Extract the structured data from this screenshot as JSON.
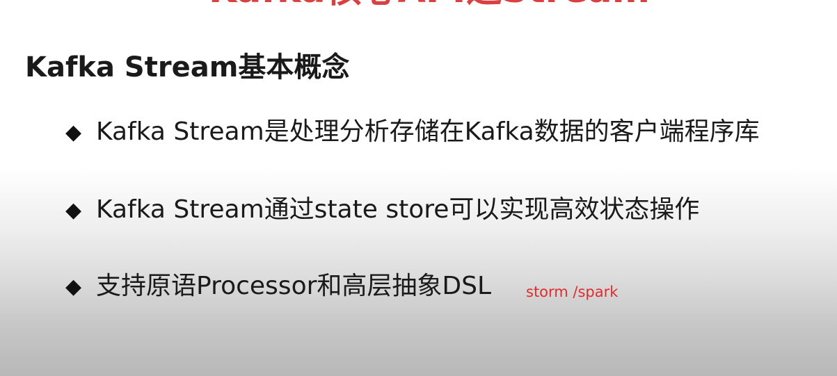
{
  "slide": {
    "top_title": "Kafka核心API之Stream",
    "section_title": "Kafka Stream基本概念",
    "bullet_symbol": "◆",
    "bullets": [
      "Kafka Stream是处理分析存储在Kafka数据的客户端程序库",
      "Kafka Stream通过state store可以实现高效状态操作",
      "支持原语Processor和高层抽象DSL"
    ],
    "annotation": "storm /spark"
  },
  "colors": {
    "title_red": "#d9403f",
    "annotation_red": "#e02c2c",
    "text": "#1a1a1a"
  }
}
